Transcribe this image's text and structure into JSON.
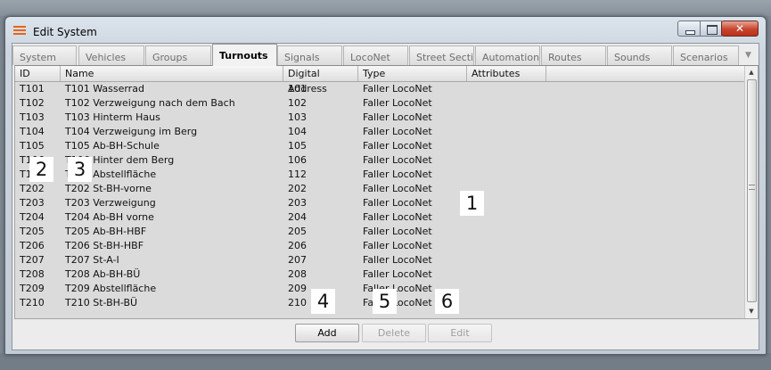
{
  "window": {
    "title": "Edit System"
  },
  "tabs": [
    {
      "label": "System"
    },
    {
      "label": "Vehicles"
    },
    {
      "label": "Groups"
    },
    {
      "label": "Turnouts",
      "active": true
    },
    {
      "label": "Signals"
    },
    {
      "label": "LocoNet"
    },
    {
      "label": "Street Sectio..."
    },
    {
      "label": "Automations"
    },
    {
      "label": "Routes"
    },
    {
      "label": "Sounds"
    },
    {
      "label": "Scenarios"
    }
  ],
  "table": {
    "columns": [
      "ID",
      "Name",
      "Digital Address",
      "Type",
      "Attributes"
    ],
    "rows": [
      [
        "T101",
        "T101 Wasserrad",
        "101",
        "Faller LocoNet"
      ],
      [
        "T102",
        "T102 Verzweigung nach dem Bach",
        "102",
        "Faller LocoNet"
      ],
      [
        "T103",
        "T103 Hinterm Haus",
        "103",
        "Faller LocoNet"
      ],
      [
        "T104",
        "T104 Verzweigung im Berg",
        "104",
        "Faller LocoNet"
      ],
      [
        "T105",
        "T105 Ab-BH-Schule",
        "105",
        "Faller LocoNet"
      ],
      [
        "T106",
        "T106 Hinter dem Berg",
        "106",
        "Faller LocoNet"
      ],
      [
        "T112",
        "T112 Abstellfläche",
        "112",
        "Faller LocoNet"
      ],
      [
        "T202",
        "T202 St-BH-vorne",
        "202",
        "Faller LocoNet"
      ],
      [
        "T203",
        "T203 Verzweigung",
        "203",
        "Faller LocoNet"
      ],
      [
        "T204",
        "T204 Ab-BH vorne",
        "204",
        "Faller LocoNet"
      ],
      [
        "T205",
        "T205 Ab-BH-HBF",
        "205",
        "Faller LocoNet"
      ],
      [
        "T206",
        "T206 St-BH-HBF",
        "206",
        "Faller LocoNet"
      ],
      [
        "T207",
        "T207 St-A-I",
        "207",
        "Faller LocoNet"
      ],
      [
        "T208",
        "T208 Ab-BH-BÜ",
        "208",
        "Faller LocoNet"
      ],
      [
        "T209",
        "T209 Abstellfläche",
        "209",
        "Faller LocoNet"
      ],
      [
        "T210",
        "T210 St-BH-BÜ",
        "210",
        "Faller LocoNet"
      ]
    ]
  },
  "buttons": {
    "add": "Add",
    "delete": "Delete",
    "edit": "Edit"
  },
  "callouts": [
    "1",
    "2",
    "3",
    "4",
    "5",
    "6"
  ],
  "icons": {
    "app": "app-menu-icon",
    "scroll_up": "scroll-up-icon",
    "scroll_down": "scroll-down-icon",
    "tabs_more": "tabs-overflow-icon"
  },
  "colors": {
    "close_button": "#c8442d",
    "app_icon": "#e8631b",
    "table_background": "#dbdbdb"
  }
}
